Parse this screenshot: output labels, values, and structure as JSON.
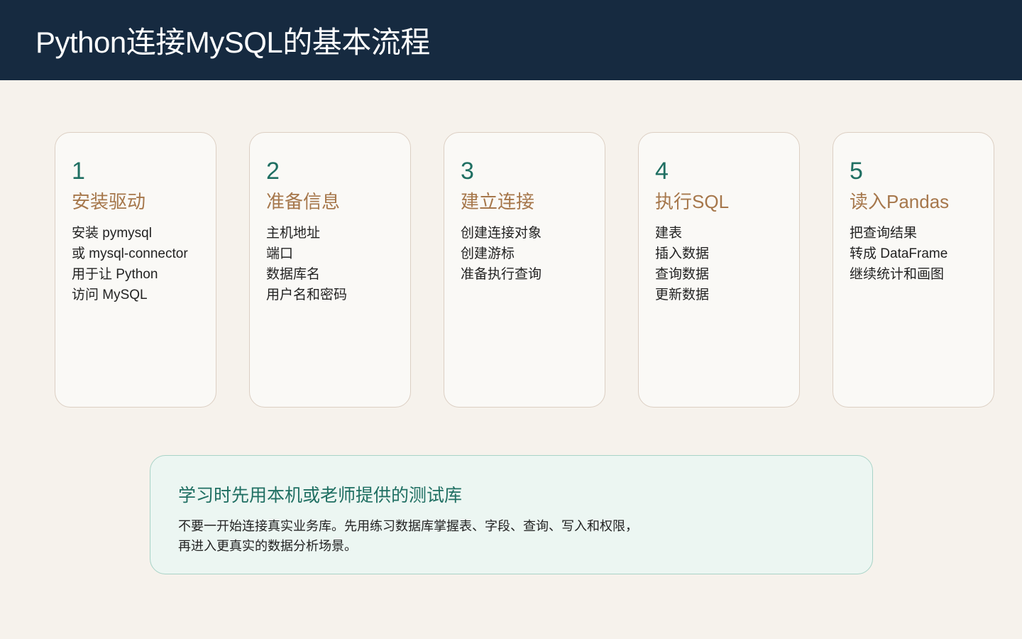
{
  "header": {
    "title": "Python连接MySQL的基本流程"
  },
  "steps": [
    {
      "number": "1",
      "title": "安装驱动",
      "lines": [
        "安装 pymysql",
        "或 mysql-connector",
        "用于让 Python",
        "访问 MySQL"
      ]
    },
    {
      "number": "2",
      "title": "准备信息",
      "lines": [
        "主机地址",
        "端口",
        "数据库名",
        "用户名和密码"
      ]
    },
    {
      "number": "3",
      "title": "建立连接",
      "lines": [
        "创建连接对象",
        "创建游标",
        "准备执行查询"
      ]
    },
    {
      "number": "4",
      "title": "执行SQL",
      "lines": [
        "建表",
        "插入数据",
        "查询数据",
        "更新数据"
      ]
    },
    {
      "number": "5",
      "title": "读入Pandas",
      "lines": [
        "把查询结果",
        "转成 DataFrame",
        "继续统计和画图"
      ]
    }
  ],
  "tip": {
    "title": "学习时先用本机或老师提供的测试库",
    "lines": [
      "不要一开始连接真实业务库。先用练习数据库掌握表、字段、查询、写入和权限，",
      "再进入更真实的数据分析场景。"
    ]
  }
}
